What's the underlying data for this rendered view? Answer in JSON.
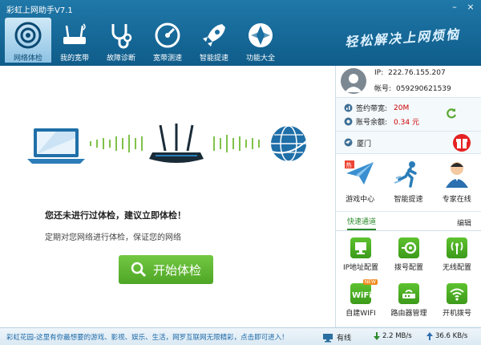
{
  "window": {
    "title": "彩虹上网助手V7.1",
    "slogan": "轻松解决上网烦恼"
  },
  "tabs": [
    {
      "label": "网络体检",
      "icon": "target-icon",
      "active": true
    },
    {
      "label": "我的宽带",
      "icon": "router-icon"
    },
    {
      "label": "故障诊断",
      "icon": "stethoscope-icon"
    },
    {
      "label": "宽带测速",
      "icon": "speedometer-icon"
    },
    {
      "label": "智能提速",
      "icon": "rocket-icon"
    },
    {
      "label": "功能大全",
      "icon": "apps-icon"
    }
  ],
  "main": {
    "message": "您还未进行过体检，建议立即体检！",
    "hint": "定期对您网络进行体检，保证您的网络",
    "start_button": "开始体检"
  },
  "account": {
    "ip_label": "IP:",
    "ip_value": "222.76.155.207",
    "account_label": "帐号:",
    "account_value": "059290621539",
    "bandwidth_label": "签约带宽:",
    "bandwidth_value": "20M",
    "balance_label": "账号余额:",
    "balance_value": "0.34 元",
    "location": "厦门"
  },
  "features": [
    {
      "label": "游戏中心",
      "icon": "paper-plane-icon"
    },
    {
      "label": "智能提速",
      "icon": "runner-icon"
    },
    {
      "label": "专家在线",
      "icon": "expert-icon"
    }
  ],
  "quick": {
    "tab_label": "快速通道",
    "edit_label": "编辑",
    "items": [
      {
        "label": "IP地址配置",
        "icon": "monitor-icon"
      },
      {
        "label": "拨号配置",
        "icon": "dial-icon"
      },
      {
        "label": "无线配置",
        "icon": "antenna-icon"
      },
      {
        "label": "自建WIFI",
        "icon": "wifi-badge-icon",
        "badge": "NEW"
      },
      {
        "label": "路由器管理",
        "icon": "router-box-icon"
      },
      {
        "label": "开机拨号",
        "icon": "wifi-icon"
      }
    ]
  },
  "status": {
    "ticker": "彩虹花园-这里有你最想要的游戏、影视、娱乐、生活，网罗互联网无限精彩，点击即可进入！",
    "network_type": "有线",
    "download": "2.2 MB/s",
    "upload": "36.6 KB/s"
  },
  "colors": {
    "titlebar": "#1a6fa0",
    "accent_green": "#4fa626",
    "warning_red": "#c00000"
  }
}
